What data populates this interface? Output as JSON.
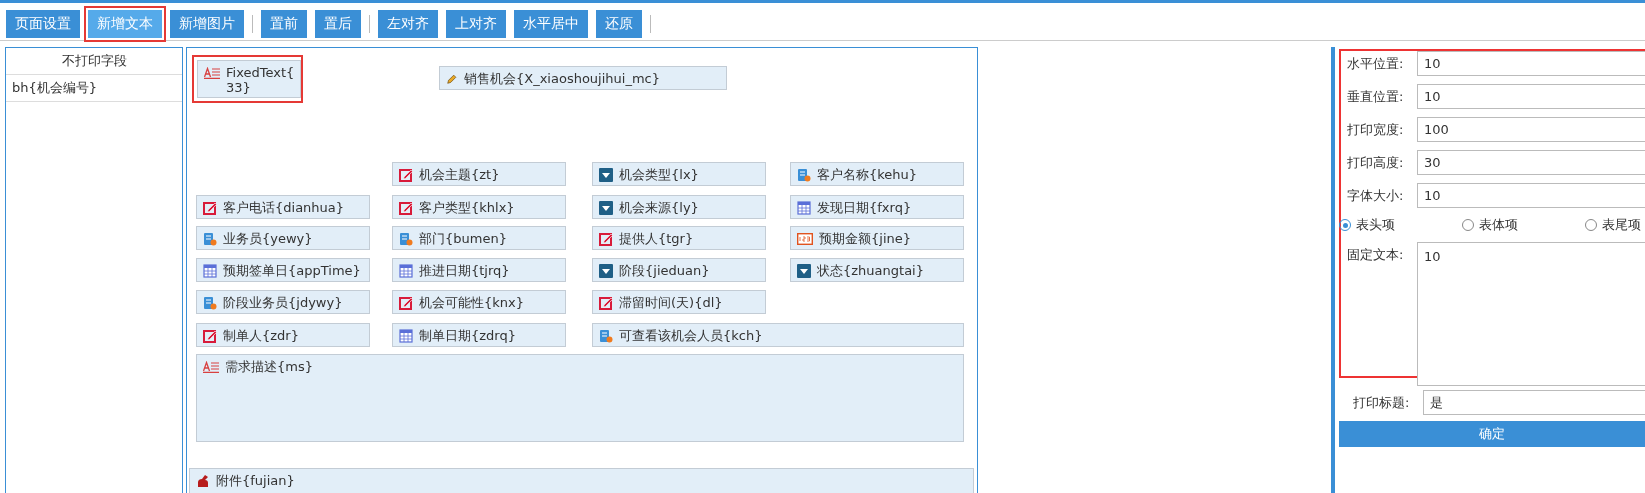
{
  "toolbar": {
    "groups": [
      [
        {
          "label": "页面设置",
          "highlighted": false
        },
        {
          "label": "新增文本",
          "highlighted": true
        },
        {
          "label": "新增图片",
          "highlighted": false
        }
      ],
      [
        {
          "label": "置前",
          "highlighted": false
        },
        {
          "label": "置后",
          "highlighted": false
        }
      ],
      [
        {
          "label": "左对齐",
          "highlighted": false
        },
        {
          "label": "上对齐",
          "highlighted": false
        },
        {
          "label": "水平居中",
          "highlighted": false
        },
        {
          "label": "还原",
          "highlighted": false
        }
      ]
    ]
  },
  "unprinted_fields": {
    "title": "不打印字段",
    "items": [
      "bh{机会编号}"
    ]
  },
  "canvas": {
    "items": [
      {
        "kind": "text",
        "label": "FixedText{\n33}",
        "highlighted": true
      },
      {
        "kind": "pencil",
        "label": "销售机会{X_xiaoshoujihui_mc}",
        "highlighted": false
      },
      {
        "kind": "edit",
        "label": "机会主题{zt}",
        "highlighted": false
      },
      {
        "kind": "dropdown",
        "label": "机会类型{lx}",
        "highlighted": false
      },
      {
        "kind": "person",
        "label": "客户名称{kehu}",
        "highlighted": false
      },
      {
        "kind": "edit",
        "label": "客户电话{dianhua}",
        "highlighted": false
      },
      {
        "kind": "edit",
        "label": "客户类型{khlx}",
        "highlighted": false
      },
      {
        "kind": "dropdown",
        "label": "机会来源{ly}",
        "highlighted": false
      },
      {
        "kind": "calendar",
        "label": "发现日期{fxrq}",
        "highlighted": false
      },
      {
        "kind": "person",
        "label": "业务员{yewy}",
        "highlighted": false
      },
      {
        "kind": "person",
        "label": "部门{bumen}",
        "highlighted": false
      },
      {
        "kind": "edit",
        "label": "提供人{tgr}",
        "highlighted": false
      },
      {
        "kind": "number",
        "label": "预期金额{jine}",
        "highlighted": false
      },
      {
        "kind": "calendar",
        "label": "预期签单日{appTime}",
        "highlighted": false
      },
      {
        "kind": "calendar",
        "label": "推进日期{tjrq}",
        "highlighted": false
      },
      {
        "kind": "dropdown",
        "label": "阶段{jieduan}",
        "highlighted": false
      },
      {
        "kind": "dropdown",
        "label": "状态{zhuangtai}",
        "highlighted": false
      },
      {
        "kind": "person",
        "label": "阶段业务员{jdywy}",
        "highlighted": false
      },
      {
        "kind": "edit",
        "label": "机会可能性{knx}",
        "highlighted": false
      },
      {
        "kind": "edit",
        "label": "滞留时间(天){dl}",
        "highlighted": false
      },
      {
        "kind": "edit",
        "label": "制单人{zdr}",
        "highlighted": false
      },
      {
        "kind": "calendar",
        "label": "制单日期{zdrq}",
        "highlighted": false
      },
      {
        "kind": "person",
        "label": "可查看该机会人员{kch}",
        "highlighted": false
      },
      {
        "kind": "text",
        "label": "需求描述{ms}",
        "highlighted": false
      },
      {
        "kind": "attachment",
        "label": "附件{fujian}",
        "highlighted": false
      }
    ]
  },
  "properties": {
    "highlighted": true,
    "fields": [
      {
        "label": "水平位置:",
        "value": "10"
      },
      {
        "label": "垂直位置:",
        "value": "10"
      },
      {
        "label": "打印宽度:",
        "value": "100"
      },
      {
        "label": "打印高度:",
        "value": "30"
      },
      {
        "label": "字体大小:",
        "value": "10"
      }
    ],
    "sections": [
      {
        "label": "表头项",
        "selected": true
      },
      {
        "label": "表体项",
        "selected": false
      },
      {
        "label": "表尾项",
        "selected": false
      }
    ],
    "fixed_text": {
      "label": "固定文本:",
      "value": "10"
    },
    "print_title": {
      "label": "打印标题:",
      "value": "是"
    },
    "confirm": "确定"
  }
}
